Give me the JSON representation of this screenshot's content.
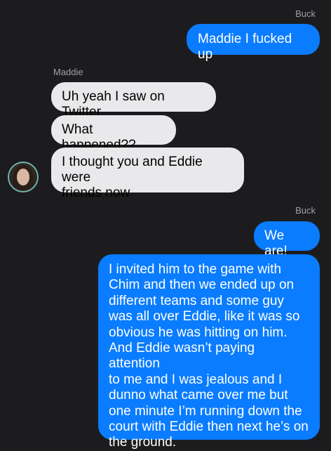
{
  "conversation": {
    "groups": [
      {
        "sender": "Buck",
        "messages": [
          "Maddie I fucked up"
        ]
      },
      {
        "sender": "Maddie",
        "messages": [
          "Uh yeah I saw on Twitter",
          "What happened??",
          "I thought you and Eddie were\nfriends now"
        ]
      },
      {
        "sender": "Buck",
        "messages": [
          "We are!",
          "I invited him to the game with\nChim and then we ended up on\ndifferent teams and some guy\nwas all over Eddie, like it was so\nobvious he was hitting on him.\nAnd Eddie wasn’t paying attention\nto me and I was jealous and I\ndunno what came over me but\none minute I’m running down the\ncourt with Eddie then next he’s on\nthe ground."
        ]
      }
    ]
  },
  "icons": {
    "avatar": "contact-avatar-photo"
  },
  "colors": {
    "background": "#1c1c1e",
    "outgoing_bubble": "#0a7cff",
    "incoming_bubble": "#e9e9eb",
    "sender_label": "#a1a1a6"
  }
}
